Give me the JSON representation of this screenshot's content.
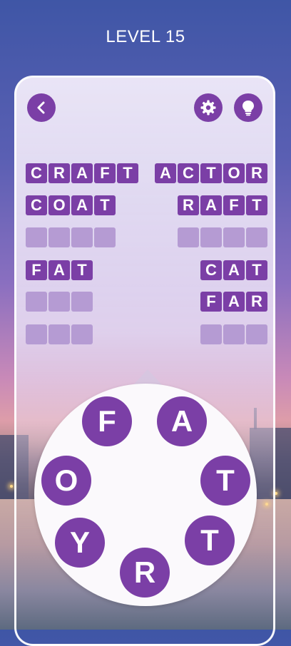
{
  "level_label": "LEVEL 15",
  "colors": {
    "accent": "#7b3fa6",
    "empty_tile": "#b59bd3",
    "text": "#ffffff"
  },
  "header": {
    "back_icon": "chevron-left-icon",
    "settings_icon": "gear-icon",
    "hint_icon": "lightbulb-icon"
  },
  "left_words": [
    {
      "letters": [
        "C",
        "R",
        "A",
        "F",
        "T"
      ],
      "solved": true
    },
    {
      "letters": [
        "C",
        "O",
        "A",
        "T"
      ],
      "solved": true
    },
    {
      "letters": [
        "",
        "",
        "",
        ""
      ],
      "solved": false
    },
    {
      "letters": [
        "F",
        "A",
        "T"
      ],
      "solved": true
    },
    {
      "letters": [
        "",
        "",
        ""
      ],
      "solved": false
    },
    {
      "letters": [
        "",
        "",
        ""
      ],
      "solved": false
    }
  ],
  "right_words": [
    {
      "letters": [
        "A",
        "C",
        "T",
        "O",
        "R"
      ],
      "solved": true
    },
    {
      "letters": [
        "R",
        "A",
        "F",
        "T"
      ],
      "solved": true
    },
    {
      "letters": [
        "",
        "",
        "",
        ""
      ],
      "solved": false
    },
    {
      "letters": [
        "C",
        "A",
        "T"
      ],
      "solved": true
    },
    {
      "letters": [
        "F",
        "A",
        "R"
      ],
      "solved": true
    },
    {
      "letters": [
        "",
        "",
        ""
      ],
      "solved": false
    }
  ],
  "wheel_letters": [
    "F",
    "A",
    "T",
    "T",
    "R",
    "Y",
    "O"
  ]
}
